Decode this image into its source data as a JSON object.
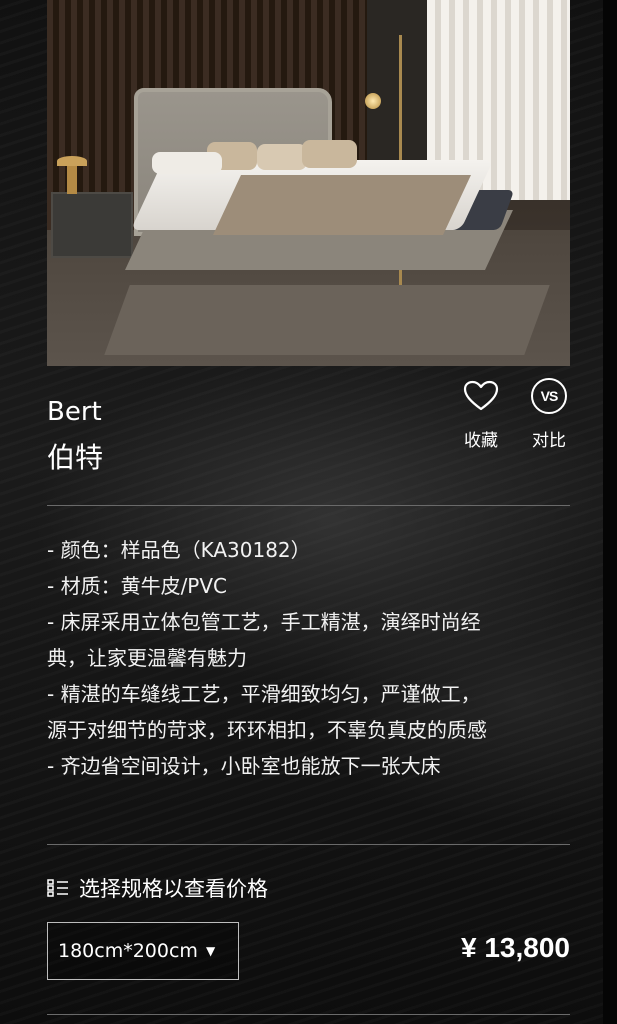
{
  "product": {
    "name_en": "Bert",
    "name_cn": "伯特",
    "image_alt": "bed-product-photo"
  },
  "actions": {
    "favorite": {
      "label": "收藏",
      "icon": "heart-icon"
    },
    "compare": {
      "label": "对比",
      "icon": "vs-icon",
      "icon_text": "VS"
    }
  },
  "features": [
    "- 颜色：样品色（KA30182）",
    "- 材质：黄牛皮/PVC",
    "- 床屏采用立体包管工艺，手工精湛，演绎时尚经",
    "典，让家更温馨有魅力",
    "- 精湛的车缝线工艺，平滑细致均匀，严谨做工，",
    "源于对细节的苛求，环环相扣，不辜负真皮的质感",
    "- 齐边省空间设计，小卧室也能放下一张大床"
  ],
  "spec": {
    "hint": "选择规格以查看价格",
    "selected_size": "180cm*200cm",
    "price": "¥ 13,800"
  },
  "colors": {
    "background": "#0b0b0b",
    "text": "#ffffff",
    "divider": "#6a6a6a"
  }
}
